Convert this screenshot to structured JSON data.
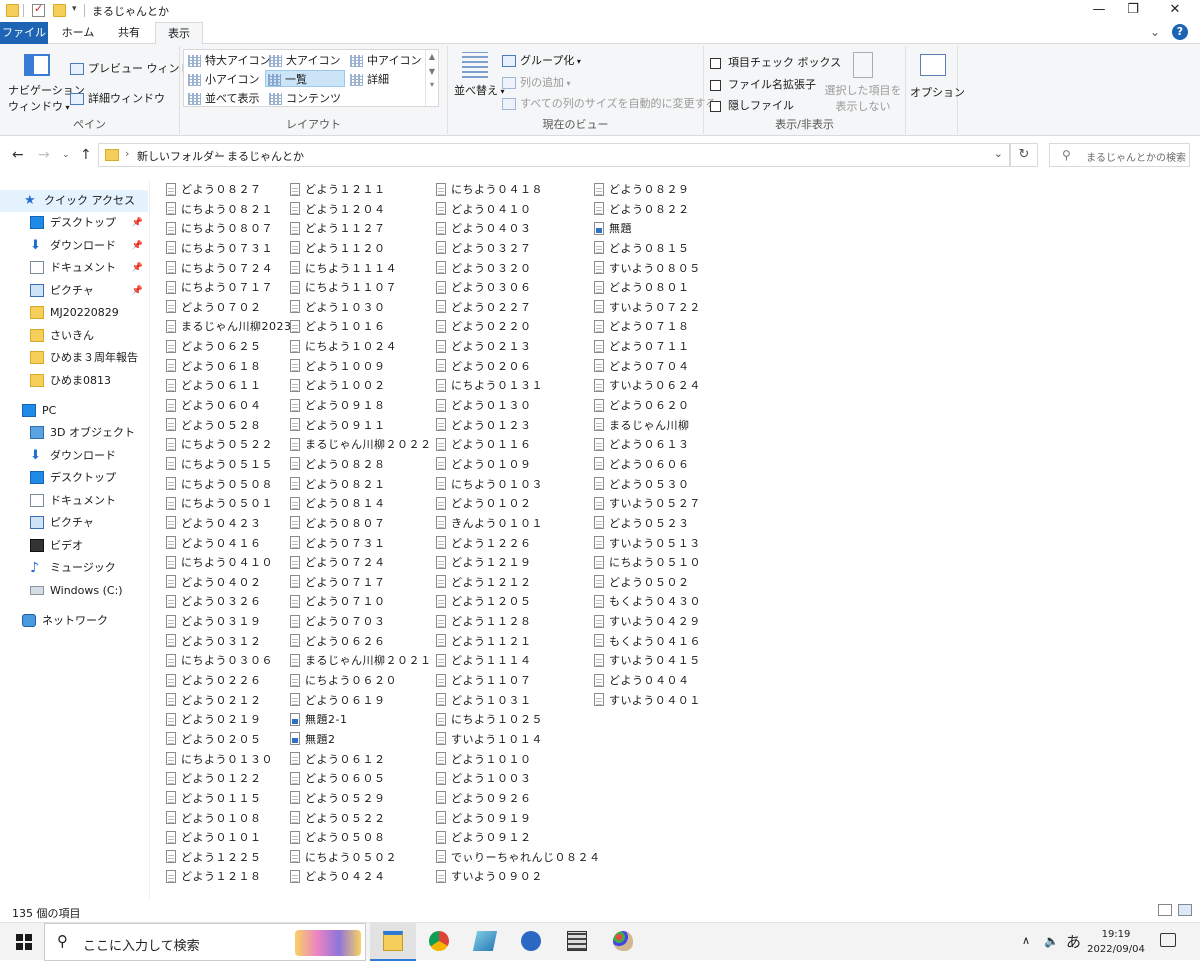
{
  "window": {
    "title": "まるじゃんとか",
    "minimize": "—",
    "maximize": "❐",
    "close": "✕"
  },
  "tabs": [
    {
      "label": "ファイル"
    },
    {
      "label": "ホーム"
    },
    {
      "label": "共有"
    },
    {
      "label": "表示"
    }
  ],
  "ribbon": {
    "pane": {
      "nav_pane_line1": "ナビゲーション",
      "nav_pane_line2": "ウィンドウ",
      "preview_pane": "プレビュー ウィンドウ",
      "details_pane": "詳細ウィンドウ",
      "label": "ペイン"
    },
    "layout": {
      "items": [
        "特大アイコン",
        "大アイコン",
        "中アイコン",
        "小アイコン",
        "一覧",
        "詳細",
        "並べて表示",
        "コンテンツ"
      ],
      "selected": "一覧",
      "label": "レイアウト"
    },
    "current_view": {
      "sort": "並べ替え",
      "group_by": "グループ化",
      "add_columns": "列の追加",
      "size_columns": "すべての列のサイズを自動的に変更する",
      "label": "現在のビュー"
    },
    "show_hide": {
      "item_checkboxes": "項目チェック ボックス",
      "file_extensions": "ファイル名拡張子",
      "hidden_items": "隠しファイル",
      "hide_selected_line1": "選択した項目を",
      "hide_selected_line2": "表示しない",
      "label": "表示/非表示"
    },
    "options": {
      "label": "オプション"
    }
  },
  "address": {
    "crumbs": [
      "新しいフォルダー",
      "まるじゃんとか"
    ],
    "search_placeholder": "まるじゃんとかの検索"
  },
  "nav_pane": {
    "quick_access": "クイック アクセス",
    "pinned": [
      {
        "label": "デスクトップ",
        "icon": "desktop-icon"
      },
      {
        "label": "ダウンロード",
        "icon": "download-icon"
      },
      {
        "label": "ドキュメント",
        "icon": "document-icon"
      },
      {
        "label": "ピクチャ",
        "icon": "picture-icon"
      }
    ],
    "recent_folders": [
      "MJ20220829",
      "さいきん",
      "ひめま３周年報告",
      "ひめま0813"
    ],
    "pc": "PC",
    "pc_items": [
      {
        "label": "3D オブジェクト",
        "icon": "3d-objects-icon"
      },
      {
        "label": "ダウンロード",
        "icon": "download-icon"
      },
      {
        "label": "デスクトップ",
        "icon": "desktop-icon"
      },
      {
        "label": "ドキュメント",
        "icon": "document-icon"
      },
      {
        "label": "ピクチャ",
        "icon": "picture-icon"
      },
      {
        "label": "ビデオ",
        "icon": "video-icon"
      },
      {
        "label": "ミュージック",
        "icon": "music-icon"
      },
      {
        "label": "Windows (C:)",
        "icon": "drive-icon"
      }
    ],
    "network": "ネットワーク"
  },
  "files": {
    "columns": [
      [
        "どよう０８２７",
        "にちよう０８２１",
        "にちよう０８０７",
        "にちよう０７３１",
        "にちよう０７２４",
        "にちよう０７１７",
        "どよう０７０２",
        "まるじゃん川柳2023",
        "どよう０６２５",
        "どよう０６１８",
        "どよう０６１１",
        "どよう０６０４",
        "どよう０５２８",
        "にちよう０５２２",
        "にちよう０５１５",
        "にちよう０５０８",
        "にちよう０５０１",
        "どよう０４２３",
        "どよう０４１６",
        "にちよう０４１０",
        "どよう０４０２",
        "どよう０３２６",
        "どよう０３１９",
        "どよう０３１２",
        "にちよう０３０６",
        "どよう０２２６",
        "どよう０２１２",
        "どよう０２１９",
        "どよう０２０５",
        "にちよう０１３０",
        "どよう０１２２",
        "どよう０１１５",
        "どよう０１０８",
        "どよう０１０１",
        "どよう１２２５",
        "どよう１２１８"
      ],
      [
        "どよう１２１１",
        "どよう１２０４",
        "どよう１１２７",
        "どよう１１２０",
        "にちよう１１１４",
        "にちよう１１０７",
        "どよう１０３０",
        "どよう１０１６",
        "にちよう１０２４",
        "どよう１００９",
        "どよう１００２",
        "どよう０９１８",
        "どよう０９１１",
        "まるじゃん川柳２０２２",
        "どよう０８２８",
        "どよう０８２１",
        "どよう０８１４",
        "どよう０８０７",
        "どよう０７３１",
        "どよう０７２４",
        "どよう０７１７",
        "どよう０７１０",
        "どよう０７０３",
        "どよう０６２６",
        "まるじゃん川柳２０２１",
        "にちよう０６２０",
        "どよう０６１９",
        "無題2-1",
        "無題2",
        "どよう０６１２",
        "どよう０６０５",
        "どよう０５２９",
        "どよう０５２２",
        "どよう０５０８",
        "にちよう０５０２",
        "どよう０４２４"
      ],
      [
        "にちよう０４１８",
        "どよう０４１０",
        "どよう０４０３",
        "どよう０３２７",
        "どよう０３２０",
        "どよう０３０６",
        "どよう０２２７",
        "どよう０２２０",
        "どよう０２１３",
        "どよう０２０６",
        "にちよう０１３１",
        "どよう０１３０",
        "どよう０１２３",
        "どよう０１１６",
        "どよう０１０９",
        "にちよう０１０３",
        "どよう０１０２",
        "きんよう０１０１",
        "どよう１２２６",
        "どよう１２１９",
        "どよう１２１２",
        "どよう１２０５",
        "どよう１１２８",
        "どよう１１２１",
        "どよう１１１４",
        "どよう１１０７",
        "どよう１０３１",
        "にちよう１０２５",
        "すいよう１０１４",
        "どよう１０１０",
        "どよう１００３",
        "どよう０９２６",
        "どよう０９１９",
        "どよう０９１２",
        "でぃりーちゃれんじ０８２４",
        "すいよう０９０２"
      ],
      [
        "どよう０８２９",
        "どよう０８２２",
        "無題",
        "どよう０８１５",
        "すいよう０８０５",
        "どよう０８０１",
        "すいよう０７２２",
        "どよう０７１８",
        "どよう０７１１",
        "どよう０７０４",
        "すいよう０６２４",
        "どよう０６２０",
        "まるじゃん川柳",
        "どよう０６１３",
        "どよう０６０６",
        "どよう０５３０",
        "すいよう０５２７",
        "どよう０５２３",
        "すいよう０５１３",
        "にちよう０５１０",
        "どよう０５０２",
        "もくよう０４３０",
        "すいよう０４２９",
        "もくよう０４１６",
        "すいよう０４１５",
        "どよう０４０４",
        "すいよう０４０１"
      ]
    ],
    "image_files": [
      "無題2-1",
      "無題2",
      "無題"
    ]
  },
  "status": {
    "item_count": "135 個の項目"
  },
  "taskbar": {
    "search_placeholder": "ここに入力して検索",
    "ime": "あ",
    "time": "19:19",
    "date": "2022/09/04"
  }
}
